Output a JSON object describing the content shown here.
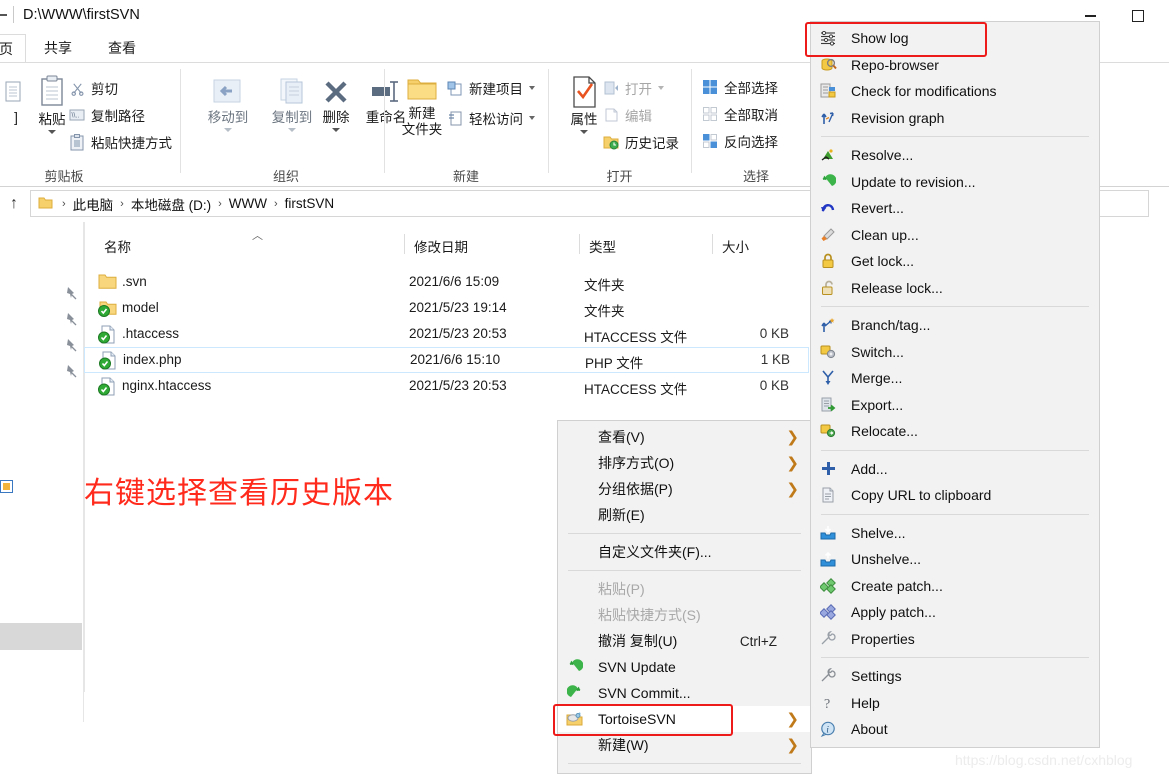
{
  "window": {
    "title": "D:\\WWW\\firstSVN",
    "minimize_label": "Minimize",
    "maximize_label": "Maximize"
  },
  "ribbon": {
    "tabs": [
      {
        "label": "页",
        "active": true
      },
      {
        "label": "共享",
        "active": false
      },
      {
        "label": "查看",
        "active": false
      }
    ],
    "groups": [
      {
        "name": "剪贴板",
        "big": [
          {
            "label": "粘贴",
            "icon": "clipboard-icon",
            "caret": true
          }
        ],
        "small": [
          {
            "label": "剪切",
            "icon": "scissors-icon",
            "dim": false
          },
          {
            "label": "复制路径",
            "icon": "copy-path-icon",
            "dim": false
          },
          {
            "label": "粘贴快捷方式",
            "icon": "paste-shortcut-icon",
            "dim": false
          }
        ]
      },
      {
        "name": "组织",
        "big": [
          {
            "label": "移动到",
            "icon": "move-to-icon",
            "caret": true,
            "dim": true
          },
          {
            "label": "复制到",
            "icon": "copy-to-icon",
            "caret": true,
            "dim": true
          },
          {
            "label": "删除",
            "icon": "delete-x-icon",
            "caret": true
          },
          {
            "label": "重命名",
            "icon": "rename-icon",
            "caret": false
          }
        ],
        "small": []
      },
      {
        "name": "新建",
        "big": [
          {
            "label": "新建\n文件夹",
            "icon": "new-folder-icon",
            "caret": false
          }
        ],
        "small": [
          {
            "label": "新建项目",
            "icon": "new-item-icon",
            "caret": true
          },
          {
            "label": "轻松访问",
            "icon": "easy-access-icon",
            "caret": true
          }
        ]
      },
      {
        "name": "打开",
        "big": [
          {
            "label": "属性",
            "icon": "properties-icon",
            "caret": true
          }
        ],
        "small": [
          {
            "label": "打开",
            "icon": "open-icon",
            "dim": true,
            "caret": true
          },
          {
            "label": "编辑",
            "icon": "edit-icon",
            "dim": true
          },
          {
            "label": "历史记录",
            "icon": "history-icon",
            "dim": false
          }
        ]
      },
      {
        "name": "选择",
        "big": [],
        "small": [
          {
            "label": "全部选择",
            "icon": "select-all-icon"
          },
          {
            "label": "全部取消",
            "icon": "select-none-icon"
          },
          {
            "label": "反向选择",
            "icon": "invert-selection-icon"
          }
        ]
      }
    ]
  },
  "address": {
    "up_label": "↑",
    "crumbs": [
      "此电脑",
      "本地磁盘 (D:)",
      "WWW",
      "firstSVN"
    ],
    "separator": "›"
  },
  "filelist": {
    "columns": [
      {
        "label": "名称",
        "sorted": true,
        "sort_glyph": "︿"
      },
      {
        "label": "修改日期"
      },
      {
        "label": "类型"
      },
      {
        "label": "大小"
      }
    ],
    "rows": [
      {
        "name": ".svn",
        "date": "2021/6/6 15:09",
        "type": "文件夹",
        "size": "",
        "icon": "folder-icon",
        "selected": false
      },
      {
        "name": "model",
        "date": "2021/5/23 19:14",
        "type": "文件夹",
        "size": "",
        "icon": "folder-svn-icon",
        "selected": false
      },
      {
        "name": ".htaccess",
        "date": "2021/5/23 20:53",
        "type": "HTACCESS 文件",
        "size": "0 KB",
        "icon": "file-svn-icon",
        "selected": false
      },
      {
        "name": "index.php",
        "date": "2021/6/6 15:10",
        "type": "PHP 文件",
        "size": "1 KB",
        "icon": "file-svn-icon",
        "selected": true
      },
      {
        "name": "nginx.htaccess",
        "date": "2021/5/23 20:53",
        "type": "HTACCESS 文件",
        "size": "0 KB",
        "icon": "file-svn-icon",
        "selected": false
      }
    ]
  },
  "annotation": {
    "text": "右键选择查看历史版本",
    "color": "#ff2a1c"
  },
  "context_menu": {
    "items": [
      {
        "label": "查看(V)",
        "submenu": true,
        "dim": false,
        "icon": null
      },
      {
        "label": "排序方式(O)",
        "submenu": true,
        "dim": false,
        "icon": null
      },
      {
        "label": "分组依据(P)",
        "submenu": true,
        "dim": false,
        "icon": null
      },
      {
        "label": "刷新(E)",
        "submenu": false,
        "dim": false,
        "icon": null
      },
      {
        "separator": true
      },
      {
        "label": "自定义文件夹(F)...",
        "submenu": false,
        "dim": false,
        "icon": null
      },
      {
        "separator": true
      },
      {
        "label": "粘贴(P)",
        "submenu": false,
        "dim": true,
        "icon": null
      },
      {
        "label": "粘贴快捷方式(S)",
        "submenu": false,
        "dim": true,
        "icon": null
      },
      {
        "label": "撤消 复制(U)",
        "submenu": false,
        "dim": false,
        "icon": null,
        "shortcut": "Ctrl+Z"
      },
      {
        "label": "SVN Update",
        "submenu": false,
        "dim": false,
        "icon": "svn-update-icon"
      },
      {
        "label": "SVN Commit...",
        "submenu": false,
        "dim": false,
        "icon": "svn-commit-icon"
      },
      {
        "label": "TortoiseSVN",
        "submenu": true,
        "dim": false,
        "icon": "tortoisesvn-icon",
        "highlighted": true
      },
      {
        "label": "新建(W)",
        "submenu": true,
        "dim": false,
        "icon": null
      }
    ],
    "arrow_glyph": "›"
  },
  "tortoise_submenu": {
    "items": [
      {
        "label": "Show log",
        "icon": "show-log-icon",
        "highlighted": true
      },
      {
        "label": "Repo-browser",
        "icon": "repo-browser-icon"
      },
      {
        "label": "Check for modifications",
        "icon": "check-modifications-icon"
      },
      {
        "label": "Revision graph",
        "icon": "revision-graph-icon"
      },
      {
        "separator": true
      },
      {
        "label": "Resolve...",
        "icon": "resolve-icon"
      },
      {
        "label": "Update to revision...",
        "icon": "update-revision-icon"
      },
      {
        "label": "Revert...",
        "icon": "revert-icon"
      },
      {
        "label": "Clean up...",
        "icon": "cleanup-icon"
      },
      {
        "label": "Get lock...",
        "icon": "get-lock-icon"
      },
      {
        "label": "Release lock...",
        "icon": "release-lock-icon"
      },
      {
        "separator": true
      },
      {
        "label": "Branch/tag...",
        "icon": "branch-tag-icon"
      },
      {
        "label": "Switch...",
        "icon": "switch-icon"
      },
      {
        "label": "Merge...",
        "icon": "merge-icon"
      },
      {
        "label": "Export...",
        "icon": "export-icon"
      },
      {
        "label": "Relocate...",
        "icon": "relocate-icon"
      },
      {
        "separator": true
      },
      {
        "label": "Add...",
        "icon": "add-icon"
      },
      {
        "label": "Copy URL to clipboard",
        "icon": "copy-url-icon"
      },
      {
        "separator": true
      },
      {
        "label": "Shelve...",
        "icon": "shelve-icon"
      },
      {
        "label": "Unshelve...",
        "icon": "unshelve-icon"
      },
      {
        "label": "Create patch...",
        "icon": "create-patch-icon"
      },
      {
        "label": "Apply patch...",
        "icon": "apply-patch-icon"
      },
      {
        "label": "Properties",
        "icon": "properties-wrench-icon"
      },
      {
        "separator": true
      },
      {
        "label": "Settings",
        "icon": "settings-icon"
      },
      {
        "label": "Help",
        "icon": "help-icon"
      },
      {
        "label": "About",
        "icon": "about-icon"
      }
    ]
  },
  "watermark": {
    "text": "https://blog.csdn.net/cxhblog"
  },
  "colors": {
    "highlight_red": "#ee1b1b",
    "annotation_red": "#ff2a1c",
    "menu_bg": "#f2f2f2",
    "selection_blue": "#cce8ff"
  }
}
